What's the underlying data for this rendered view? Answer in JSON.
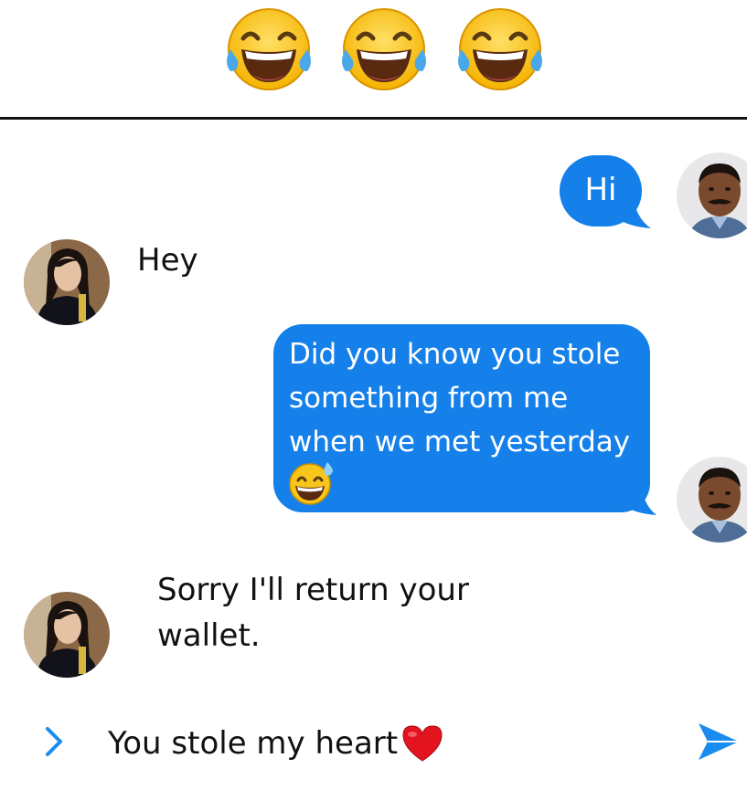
{
  "header": {
    "emojis": [
      "laughing-tears-emoji",
      "laughing-tears-emoji",
      "laughing-tears-emoji"
    ]
  },
  "messages": [
    {
      "sender": "me",
      "text": "Hi"
    },
    {
      "sender": "her",
      "text": "Hey"
    },
    {
      "sender": "me",
      "lines": [
        "Did you know you stole",
        "something from me",
        "when we met yesterday"
      ],
      "emoji": "grinning-sweat-emoji"
    },
    {
      "sender": "her",
      "lines": [
        "Sorry I'll return your",
        "wallet."
      ]
    }
  ],
  "composer": {
    "value": "You stole my heart",
    "value_emoji": "red-heart-emoji",
    "icons": {
      "expand": "chevron-right-icon",
      "send": "send-arrow-icon"
    }
  },
  "colors": {
    "bubble": "#1580ea",
    "accent": "#1a8cf0",
    "text": "#111111"
  }
}
